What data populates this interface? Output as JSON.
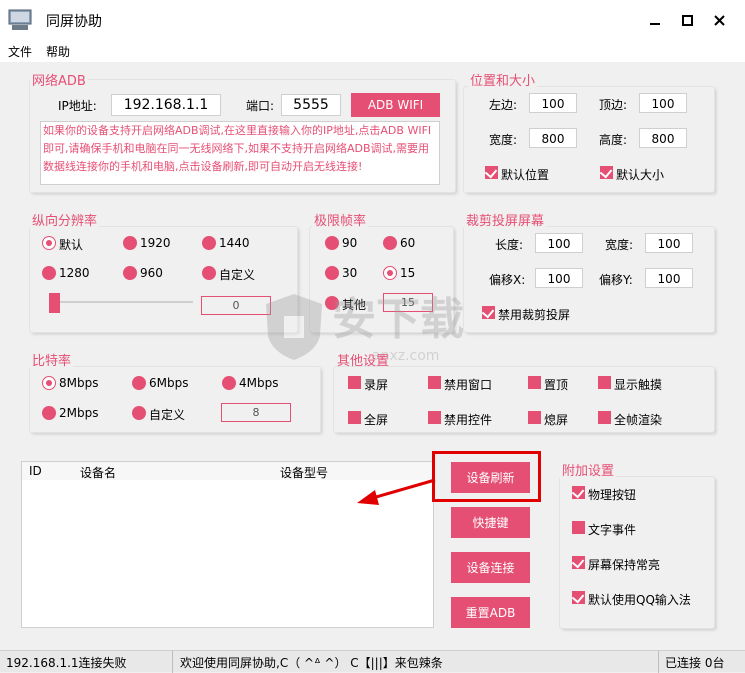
{
  "app": {
    "title": "同屏协助"
  },
  "menu": {
    "file": "文件",
    "help": "帮助"
  },
  "network": {
    "title": "网络ADB",
    "ip_label": "IP地址:",
    "ip_value": "192.168.1.1",
    "port_label": "端口:",
    "port_value": "5555",
    "button": "ADB WIFI",
    "notice": "如果你的设备支持开启网络ADB调试,在这里直接输入你的IP地址,点击ADB WIFI即可,请确保手机和电脑在同一无线网络下,如果不支持开启网络ADB调试,需要用数据线连接你的手机和电脑,点击设备刷新,即可自动开启无线连接!"
  },
  "position": {
    "title": "位置和大小",
    "left_label": "左边:",
    "left_value": "100",
    "top_label": "顶边:",
    "top_value": "100",
    "width_label": "宽度:",
    "width_value": "800",
    "height_label": "高度:",
    "height_value": "800",
    "default_pos": "默认位置",
    "default_size": "默认大小"
  },
  "resolution": {
    "title": "纵向分辨率",
    "options": [
      "默认",
      "1920",
      "1440",
      "1280",
      "960",
      "自定义"
    ],
    "selected": "默认",
    "slider_value": "0"
  },
  "fps": {
    "title": "极限帧率",
    "options": [
      "90",
      "60",
      "30",
      "15",
      "其他"
    ],
    "selected": "15",
    "other_value": "15"
  },
  "crop": {
    "title": "裁剪投屏屏幕",
    "length_label": "长度:",
    "length_value": "100",
    "width_label": "宽度:",
    "width_value": "100",
    "offx_label": "偏移X:",
    "offx_value": "100",
    "offy_label": "偏移Y:",
    "offy_value": "100",
    "disable": "禁用裁剪投屏"
  },
  "bitrate": {
    "title": "比特率",
    "options": [
      "8Mbps",
      "6Mbps",
      "4Mbps",
      "2Mbps",
      "自定义"
    ],
    "selected": "8Mbps",
    "custom_value": "8"
  },
  "other": {
    "title": "其他设置",
    "items": [
      "录屏",
      "禁用窗口",
      "置顶",
      "显示触摸",
      "全屏",
      "禁用控件",
      "熄屏",
      "全帧渲染"
    ]
  },
  "devices": {
    "col_id": "ID",
    "col_name": "设备名",
    "col_model": "设备型号"
  },
  "actions": {
    "refresh": "设备刷新",
    "shortcut": "快捷键",
    "connect": "设备连接",
    "reset": "重置ADB"
  },
  "extra": {
    "title": "附加设置",
    "items": [
      "物理按钮",
      "文字事件",
      "屏幕保持常亮",
      "默认使用QQ输入法"
    ],
    "checked": [
      true,
      false,
      true,
      true
    ]
  },
  "status": {
    "left": "192.168.1.1连接失败",
    "middle": "欢迎使用同屏协助,C（ ^ᐞ ^） C【|||】来包辣条",
    "right": "已连接 0台"
  },
  "watermark": {
    "text": "安下载",
    "sub": "anxz.com"
  },
  "colors": {
    "accent": "#e64f74",
    "highlight": "#e00000"
  }
}
